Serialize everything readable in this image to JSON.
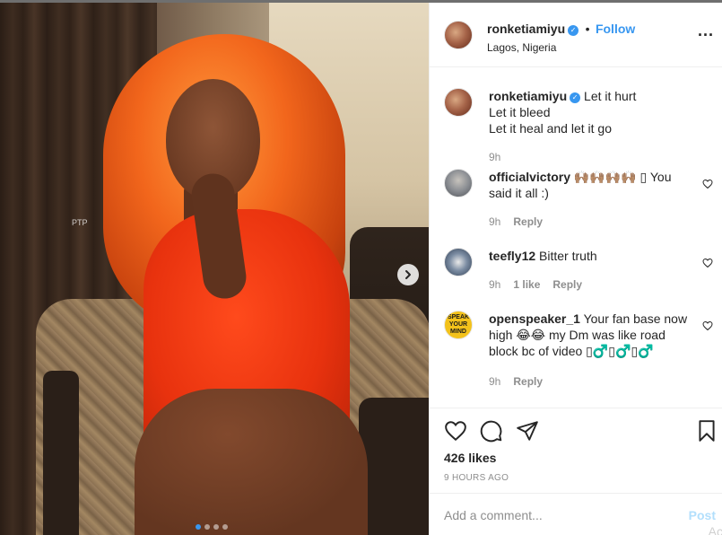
{
  "post": {
    "author": "ronketiamiyu",
    "location": "Lagos, Nigeria",
    "follow_label": "Follow",
    "separator": "•",
    "more_label": "...",
    "image_watermark": "PTP",
    "carousel": {
      "total": 4,
      "active": 1
    }
  },
  "caption": {
    "user": "ronketiamiyu",
    "lines": [
      "Let it hurt",
      "Let it bleed",
      "Let it heal and let it go"
    ],
    "time": "9h"
  },
  "comments": [
    {
      "user": "officialvictory",
      "text": "🙌🏽🙌🏽🙌🏽🙌🏽 ▯ You said it all :)",
      "time": "9h",
      "likes": "",
      "reply_label": "Reply"
    },
    {
      "user": "teefly12",
      "text": "Bitter truth",
      "time": "9h",
      "likes": "1 like",
      "reply_label": "Reply"
    },
    {
      "user": "openspeaker_1",
      "text": "Your fan base now high 😂😂 my Dm was like road block bc of video ▯♂️▯♂️▯♂️",
      "time": "9h",
      "likes": "",
      "reply_label": "Reply"
    }
  ],
  "openspeaker_avatar_text": "SPEAK YOUR MIND",
  "stats": {
    "likes": "426 likes",
    "time_ago": "9 HOURS AGO"
  },
  "composer": {
    "placeholder": "Add a comment...",
    "post_label": "Post",
    "overlay_text": "Ac"
  },
  "colors": {
    "accent": "#3897f0",
    "muted": "#8e8e8e",
    "post_disabled": "#b2dffc"
  }
}
